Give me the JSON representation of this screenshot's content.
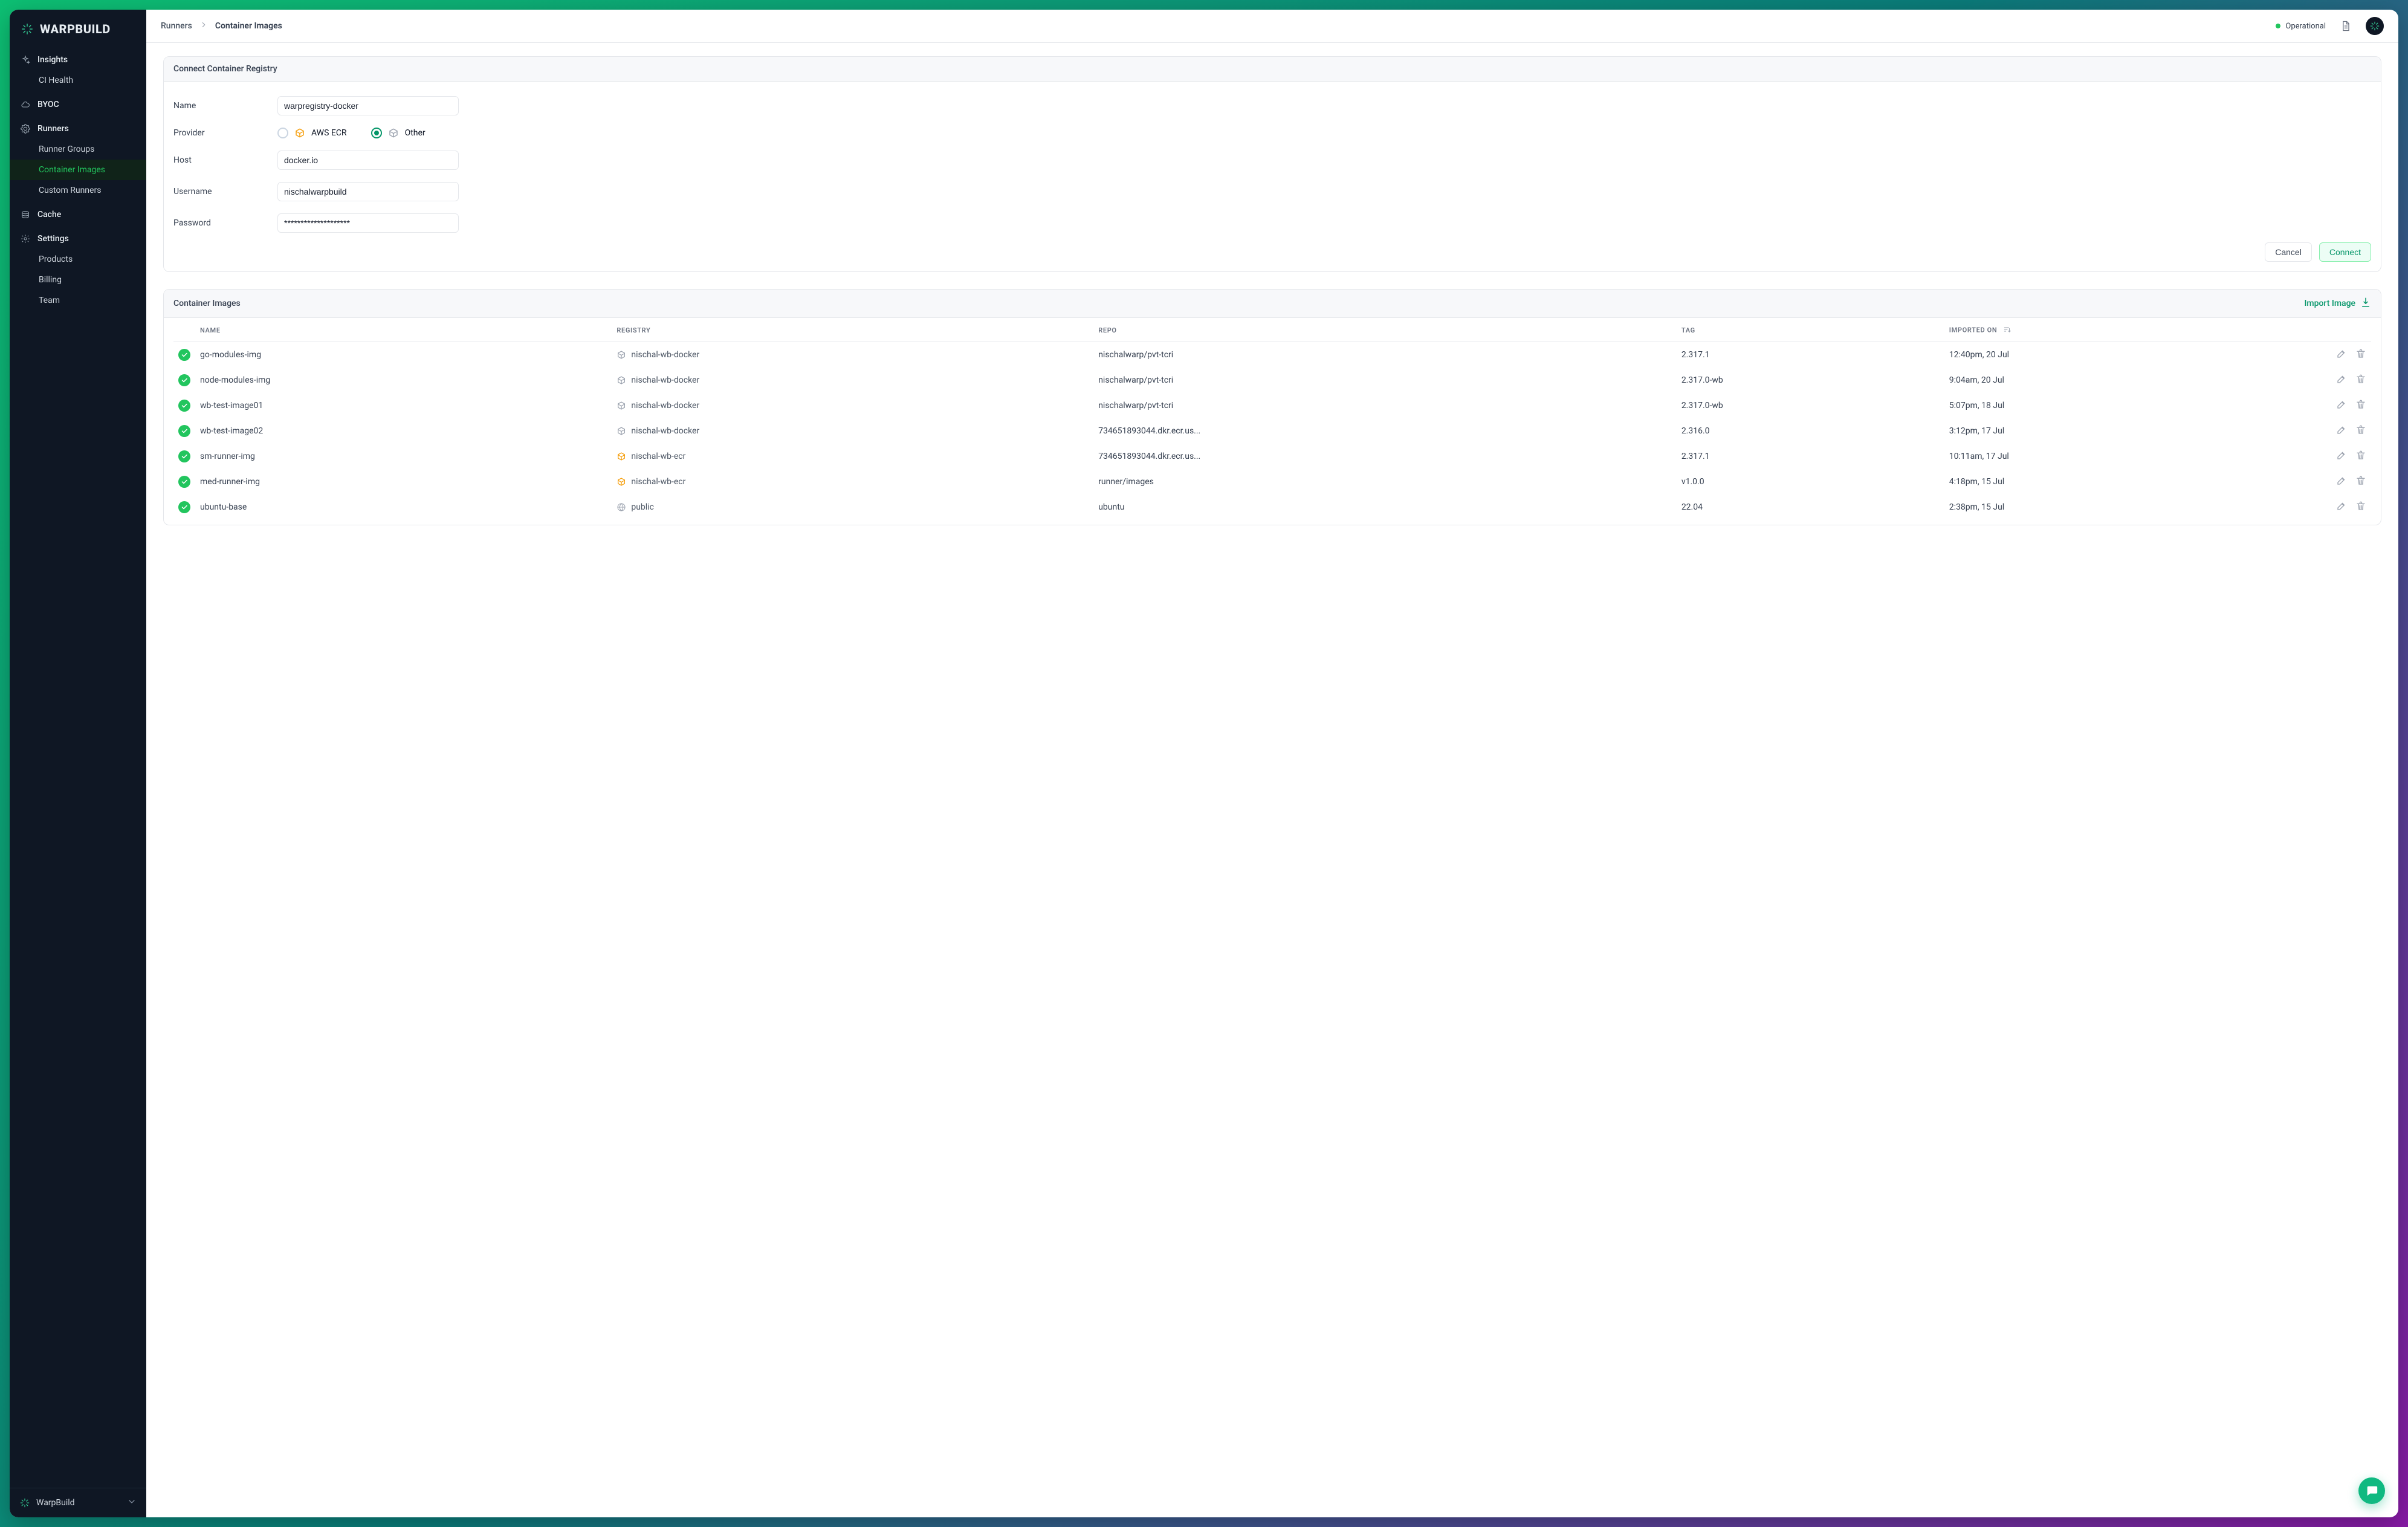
{
  "brand": {
    "name": "WARPBUILD",
    "footer_label": "WarpBuild"
  },
  "sidebar": {
    "items": [
      {
        "label": "Insights",
        "kind": "group",
        "icon": "sparkle"
      },
      {
        "label": "CI Health",
        "kind": "child"
      },
      {
        "label": "BYOC",
        "kind": "group",
        "icon": "cloud"
      },
      {
        "label": "Runners",
        "kind": "group",
        "icon": "gear"
      },
      {
        "label": "Runner Groups",
        "kind": "child"
      },
      {
        "label": "Container Images",
        "kind": "child",
        "active": true
      },
      {
        "label": "Custom Runners",
        "kind": "child"
      },
      {
        "label": "Cache",
        "kind": "group",
        "icon": "stack"
      },
      {
        "label": "Settings",
        "kind": "group",
        "icon": "cog"
      },
      {
        "label": "Products",
        "kind": "child"
      },
      {
        "label": "Billing",
        "kind": "child"
      },
      {
        "label": "Team",
        "kind": "child"
      }
    ]
  },
  "breadcrumb": {
    "root": "Runners",
    "current": "Container Images"
  },
  "topbar": {
    "status": "Operational"
  },
  "registry_form": {
    "title": "Connect Container Registry",
    "labels": {
      "name": "Name",
      "provider": "Provider",
      "host": "Host",
      "username": "Username",
      "password": "Password"
    },
    "values": {
      "name": "warpregistry-docker",
      "host": "docker.io",
      "username": "nischalwarpbuild",
      "password": "********************"
    },
    "providers": {
      "aws_label": "AWS ECR",
      "other_label": "Other",
      "selected": "other"
    },
    "actions": {
      "cancel": "Cancel",
      "connect": "Connect"
    }
  },
  "images_panel": {
    "title": "Container Images",
    "import_label": "Import Image",
    "columns": {
      "name": "NAME",
      "registry": "REGISTRY",
      "repo": "REPO",
      "tag": "TAG",
      "imported_on": "IMPORTED ON"
    },
    "rows": [
      {
        "name": "go-modules-img",
        "registry": "nischal-wb-docker",
        "reg_type": "docker",
        "repo": "nischalwarp/pvt-tcri",
        "tag": "2.317.1",
        "imported_on": "12:40pm, 20 Jul"
      },
      {
        "name": "node-modules-img",
        "registry": "nischal-wb-docker",
        "reg_type": "docker",
        "repo": "nischalwarp/pvt-tcri",
        "tag": "2.317.0-wb",
        "imported_on": "9:04am, 20 Jul"
      },
      {
        "name": "wb-test-image01",
        "registry": "nischal-wb-docker",
        "reg_type": "docker",
        "repo": "nischalwarp/pvt-tcri",
        "tag": "2.317.0-wb",
        "imported_on": "5:07pm, 18 Jul"
      },
      {
        "name": "wb-test-image02",
        "registry": "nischal-wb-docker",
        "reg_type": "docker",
        "repo": "734651893044.dkr.ecr.us...",
        "tag": "2.316.0",
        "imported_on": "3:12pm, 17 Jul"
      },
      {
        "name": "sm-runner-img",
        "registry": "nischal-wb-ecr",
        "reg_type": "aws",
        "repo": "734651893044.dkr.ecr.us...",
        "tag": "2.317.1",
        "imported_on": "10:11am, 17 Jul"
      },
      {
        "name": "med-runner-img",
        "registry": "nischal-wb-ecr",
        "reg_type": "aws",
        "repo": "runner/images",
        "tag": "v1.0.0",
        "imported_on": "4:18pm, 15 Jul"
      },
      {
        "name": "ubuntu-base",
        "registry": "public",
        "reg_type": "public",
        "repo": "ubuntu",
        "tag": "22.04",
        "imported_on": "2:38pm, 15 Jul"
      }
    ]
  }
}
